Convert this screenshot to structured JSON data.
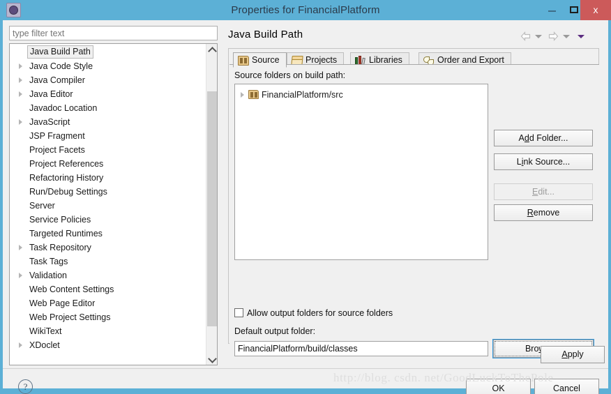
{
  "window": {
    "title": "Properties for FinancialPlatform",
    "app_icon": "gear-icon",
    "minimize_label": "–",
    "maximize_label": "□",
    "close_label": "x",
    "titlebar_color": "#5cb0d6",
    "close_button_color": "#cc5a5a"
  },
  "sidebar": {
    "filter": {
      "value": "",
      "placeholder": "type filter text"
    },
    "items": [
      {
        "label": "Java Build Path",
        "expandable": false,
        "selected": true
      },
      {
        "label": "Java Code Style",
        "expandable": true,
        "selected": false
      },
      {
        "label": "Java Compiler",
        "expandable": true,
        "selected": false
      },
      {
        "label": "Java Editor",
        "expandable": true,
        "selected": false
      },
      {
        "label": "Javadoc Location",
        "expandable": false,
        "selected": false
      },
      {
        "label": "JavaScript",
        "expandable": true,
        "selected": false
      },
      {
        "label": "JSP Fragment",
        "expandable": false,
        "selected": false
      },
      {
        "label": "Project Facets",
        "expandable": false,
        "selected": false
      },
      {
        "label": "Project References",
        "expandable": false,
        "selected": false
      },
      {
        "label": "Refactoring History",
        "expandable": false,
        "selected": false
      },
      {
        "label": "Run/Debug Settings",
        "expandable": false,
        "selected": false
      },
      {
        "label": "Server",
        "expandable": false,
        "selected": false
      },
      {
        "label": "Service Policies",
        "expandable": false,
        "selected": false
      },
      {
        "label": "Targeted Runtimes",
        "expandable": false,
        "selected": false
      },
      {
        "label": "Task Repository",
        "expandable": true,
        "selected": false
      },
      {
        "label": "Task Tags",
        "expandable": false,
        "selected": false
      },
      {
        "label": "Validation",
        "expandable": true,
        "selected": false
      },
      {
        "label": "Web Content Settings",
        "expandable": false,
        "selected": false
      },
      {
        "label": "Web Page Editor",
        "expandable": false,
        "selected": false
      },
      {
        "label": "Web Project Settings",
        "expandable": false,
        "selected": false
      },
      {
        "label": "WikiText",
        "expandable": false,
        "selected": false
      },
      {
        "label": "XDoclet",
        "expandable": true,
        "selected": false
      }
    ]
  },
  "page": {
    "title": "Java Build Path",
    "nav": {
      "back_icon": "back-arrow-icon",
      "back_menu_icon": "chevron-down-icon",
      "forward_icon": "forward-arrow-icon",
      "forward_menu_icon": "chevron-down-icon",
      "menu_icon": "chevron-down-icon"
    },
    "tabs": [
      {
        "label": "Source",
        "icon": "package-icon",
        "active": true
      },
      {
        "label": "Projects",
        "icon": "folder-open-icon",
        "active": false
      },
      {
        "label": "Libraries",
        "icon": "books-icon",
        "active": false
      },
      {
        "label": "Order and Export",
        "icon": "order-export-icon",
        "active": false
      }
    ],
    "source": {
      "list_label": "Source folders on build path:",
      "entries": [
        {
          "label": "FinancialPlatform/src",
          "icon": "package-icon",
          "expandable": true
        }
      ],
      "buttons": [
        {
          "id": "add-folder",
          "label": "Add Folder...",
          "mnemonic": "d",
          "enabled": true
        },
        {
          "id": "link-source",
          "label": "Link Source...",
          "mnemonic": "i",
          "enabled": true
        },
        {
          "id": "edit",
          "label": "Edit...",
          "mnemonic": "E",
          "enabled": false
        },
        {
          "id": "remove",
          "label": "Remove",
          "mnemonic": "R",
          "enabled": true
        }
      ],
      "allow_output_folders": {
        "label": "Allow output folders for source folders",
        "checked": false
      },
      "default_output": {
        "label": "Default output folder:",
        "value": "FinancialPlatform/build/classes"
      },
      "browse_label": "Browse..."
    },
    "apply_label": "Apply"
  },
  "footer": {
    "help_icon": "help-icon",
    "help_label": "?",
    "ok_label": "OK",
    "cancel_label": "Cancel"
  },
  "watermark": {
    "text": "http://blog. csdn. net/GoodLuckToThePole"
  }
}
